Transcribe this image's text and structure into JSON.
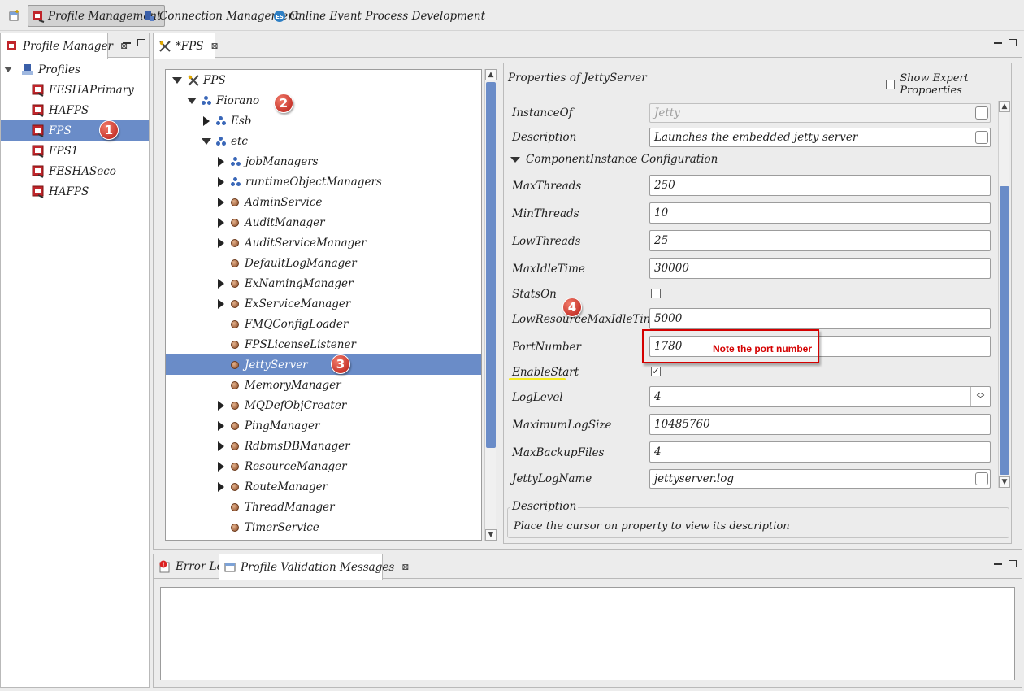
{
  "perspectives": [
    {
      "label": "Profile Management",
      "icon": "profile-management-icon",
      "active": true
    },
    {
      "label": "Connection Management",
      "icon": "connection-icon"
    },
    {
      "label": "Online Event Process Development",
      "icon": "event-process-icon"
    }
  ],
  "profile_manager": {
    "tab_label": "Profile Manager",
    "root": "Profiles",
    "items": [
      "FESHAPrimary",
      "HAFPS",
      "FPS",
      "FPS1",
      "FESHASeco",
      "HAFPS"
    ],
    "selected": "FPS"
  },
  "editor": {
    "tab_label": "*FPS",
    "tree": [
      {
        "label": "FPS",
        "kind": "root"
      },
      {
        "label": "Fiorano",
        "kind": "cluster"
      },
      {
        "label": "Esb",
        "kind": "cluster"
      },
      {
        "label": "etc",
        "kind": "cluster"
      },
      {
        "label": "jobManagers",
        "kind": "cluster"
      },
      {
        "label": "runtimeObjectManagers",
        "kind": "cluster"
      },
      {
        "label": "AdminService",
        "kind": "bean"
      },
      {
        "label": "AuditManager",
        "kind": "bean"
      },
      {
        "label": "AuditServiceManager",
        "kind": "bean"
      },
      {
        "label": "DefaultLogManager",
        "kind": "bean"
      },
      {
        "label": "ExNamingManager",
        "kind": "bean"
      },
      {
        "label": "ExServiceManager",
        "kind": "bean"
      },
      {
        "label": "FMQConfigLoader",
        "kind": "bean"
      },
      {
        "label": "FPSLicenseListener",
        "kind": "bean"
      },
      {
        "label": "JettyServer",
        "kind": "bean",
        "selected": true
      },
      {
        "label": "MemoryManager",
        "kind": "bean"
      },
      {
        "label": "MQDefObjCreater",
        "kind": "bean"
      },
      {
        "label": "PingManager",
        "kind": "bean"
      },
      {
        "label": "RdbmsDBManager",
        "kind": "bean"
      },
      {
        "label": "ResourceManager",
        "kind": "bean"
      },
      {
        "label": "RouteManager",
        "kind": "bean"
      },
      {
        "label": "ThreadManager",
        "kind": "bean"
      },
      {
        "label": "TimerService",
        "kind": "bean"
      }
    ]
  },
  "properties": {
    "title": "Properties of JettyServer",
    "show_expert_label": "Show Expert Propoerties",
    "instance_of_label": "InstanceOf",
    "instance_of_value": "Jetty",
    "description_label": "Description",
    "description_value": "Launches the embedded jetty server",
    "section_label": "ComponentInstance Configuration",
    "fields": {
      "max_threads": {
        "label": "MaxThreads",
        "value": "250"
      },
      "min_threads": {
        "label": "MinThreads",
        "value": "10"
      },
      "low_threads": {
        "label": "LowThreads",
        "value": "25"
      },
      "max_idle_time": {
        "label": "MaxIdleTime",
        "value": "30000"
      },
      "stats_on": {
        "label": "StatsOn",
        "checked": false
      },
      "low_resource_max_idle": {
        "label": "LowResourceMaxIdleTime",
        "value": "5000"
      },
      "port_number": {
        "label": "PortNumber",
        "value": "1780"
      },
      "enable_start": {
        "label": "EnableStart",
        "checked": true
      },
      "log_level": {
        "label": "LogLevel",
        "value": "4"
      },
      "max_log_size": {
        "label": "MaximumLogSize",
        "value": "10485760"
      },
      "max_backup_files": {
        "label": "MaxBackupFiles",
        "value": "4"
      },
      "jetty_log_name": {
        "label": "JettyLogName",
        "value": "jettyserver.log"
      }
    },
    "desc_group_label": "Description",
    "desc_group_text": "Place the cursor on property to view its description"
  },
  "bottom": {
    "tabs": [
      {
        "label": "Error Log"
      },
      {
        "label": "Profile Validation Messages",
        "active": true
      }
    ]
  },
  "annotations": {
    "badges": [
      "1",
      "2",
      "3",
      "4"
    ],
    "note": "Note the port number",
    "note_color": "#d40000",
    "underline_color": "#f4ea1c"
  },
  "colors": {
    "selection": "#6a8cc8",
    "badge": "#c82a20"
  }
}
